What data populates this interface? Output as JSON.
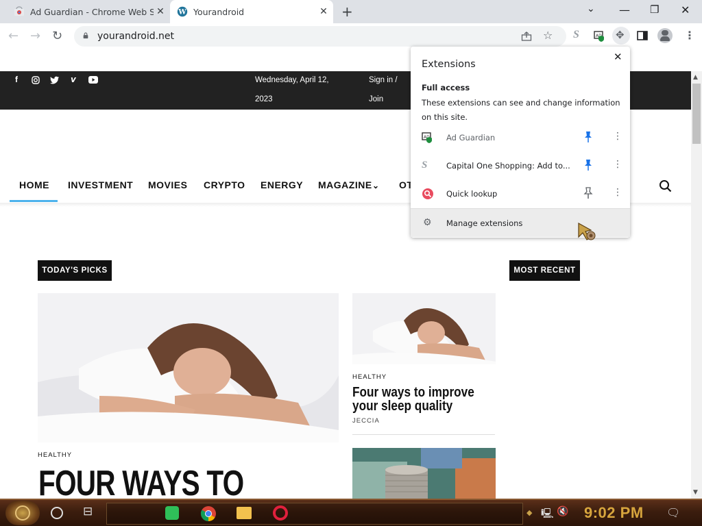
{
  "browser": {
    "tabs": [
      {
        "title": "Ad Guardian - Chrome Web Store",
        "active": false
      },
      {
        "title": "Yourandroid",
        "active": true
      }
    ],
    "new_tab_icon": "plus-icon",
    "url": "yourandroid.net",
    "window_controls": [
      "minimize-icon",
      "restore-icon",
      "close-icon"
    ]
  },
  "site": {
    "social": [
      "f",
      "ig",
      "tw",
      "v",
      "yt"
    ],
    "date_line1": "Wednesday, April 12,",
    "date_line2": "2023",
    "signin": "Sign in /",
    "join": "Join",
    "nav": [
      "HOME",
      "INVESTMENT",
      "MOVIES",
      "CRYPTO",
      "ENERGY",
      "MAGAZINE",
      "OT"
    ],
    "todays_picks": "TODAY'S PICKS",
    "most_recent": "MOST RECENT",
    "big_category": "HEALTHY",
    "big_title": "FOUR WAYS TO",
    "small_category": "HEALTHY",
    "small_title": "Four ways to improve your sleep quality",
    "small_author": "JECCIA"
  },
  "extensions_panel": {
    "title": "Extensions",
    "full_access_heading": "Full access",
    "full_access_desc": "These extensions can see and change information on this site.",
    "items": [
      {
        "name": "Ad Guardian",
        "pinned": true
      },
      {
        "name": "Capital One Shopping: Add to...",
        "pinned": true
      },
      {
        "name": "Quick lookup",
        "pinned": false
      }
    ],
    "manage": "Manage extensions"
  },
  "taskbar": {
    "clock": "9:02 PM"
  },
  "colors": {
    "accent": "#4db2ec",
    "pin_blue": "#1a73e8",
    "topbar": "#222222",
    "clock": "#d7a53d"
  }
}
